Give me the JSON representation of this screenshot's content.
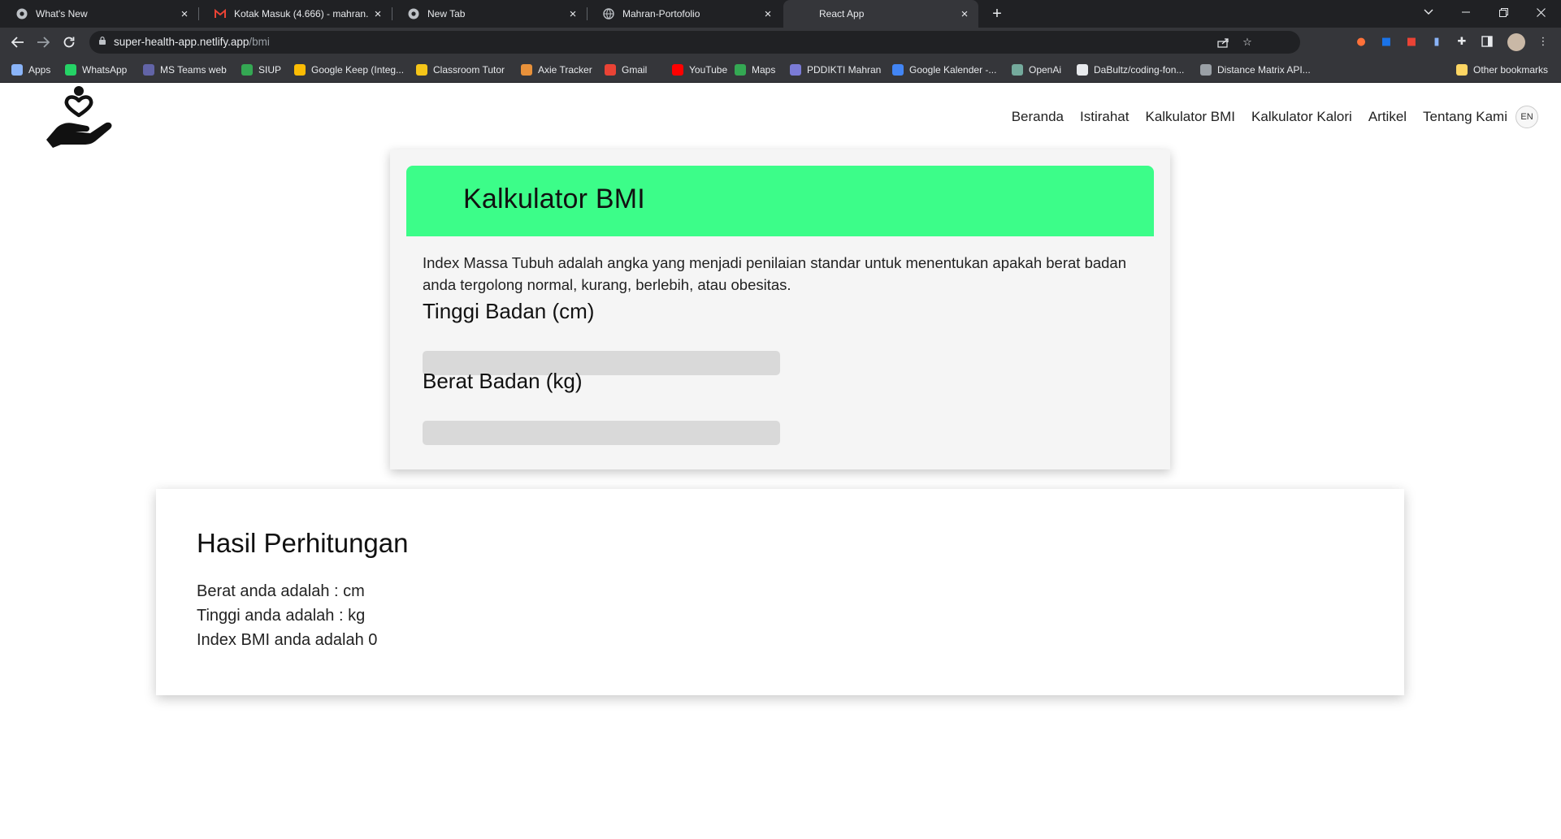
{
  "browser": {
    "tabs": [
      {
        "title": "What's New",
        "icon": "chrome-icon"
      },
      {
        "title": "Kotak Masuk (4.666) - mahran.raj",
        "icon": "gmail-icon"
      },
      {
        "title": "New Tab",
        "icon": "chrome-icon"
      },
      {
        "title": "Mahran-Portofolio",
        "icon": "globe-icon"
      },
      {
        "title": "React App",
        "icon": "react-icon"
      }
    ],
    "new_tab": "+",
    "url_host": "super-health-app.netlify.app",
    "url_path": "/bmi",
    "bookmarks": [
      {
        "label": "Apps",
        "color": "#8ab4f8"
      },
      {
        "label": "WhatsApp",
        "color": "#25d366"
      },
      {
        "label": "MS Teams web",
        "color": "#6264a7"
      },
      {
        "label": "SIUP",
        "color": "#34a853"
      },
      {
        "label": "Google Keep (Integ...",
        "color": "#fbbc04"
      },
      {
        "label": "Classroom Tutor",
        "color": "#f5c518"
      },
      {
        "label": "Axie Tracker",
        "color": "#e8913a"
      },
      {
        "label": "Gmail",
        "color": "#ea4335"
      },
      {
        "label": "YouTube",
        "color": "#ff0000"
      },
      {
        "label": "Maps",
        "color": "#34a853"
      },
      {
        "label": "PDDIKTI Mahran",
        "color": "#7b7bd6"
      },
      {
        "label": "Google Kalender -...",
        "color": "#4285f4"
      },
      {
        "label": "OpenAi",
        "color": "#74aa9c"
      },
      {
        "label": "DaBultz/coding-fon...",
        "color": "#e8eaed"
      },
      {
        "label": "Distance Matrix API...",
        "color": "#9aa0a6"
      }
    ],
    "other_bookmarks": "Other bookmarks"
  },
  "site": {
    "nav": [
      "Beranda",
      "Istirahat",
      "Kalkulator BMI",
      "Kalkulator Kalori",
      "Artikel",
      "Tentang Kami"
    ],
    "lang": "EN"
  },
  "calculator": {
    "title": "Kalkulator BMI",
    "description": "Index Massa Tubuh adalah angka yang menjadi penilaian standar untuk menentukan apakah berat badan anda tergolong normal, kurang, berlebih, atau obesitas.",
    "height_label": "Tinggi Badan (cm)",
    "height_value": "",
    "weight_label": "Berat Badan (kg)",
    "weight_value": "",
    "accent": "#3cfd89"
  },
  "result": {
    "title": "Hasil Perhitungan",
    "weight_line": "Berat anda adalah : cm",
    "height_line": "Tinggi anda adalah : kg",
    "bmi_line": "Index BMI anda adalah 0"
  }
}
